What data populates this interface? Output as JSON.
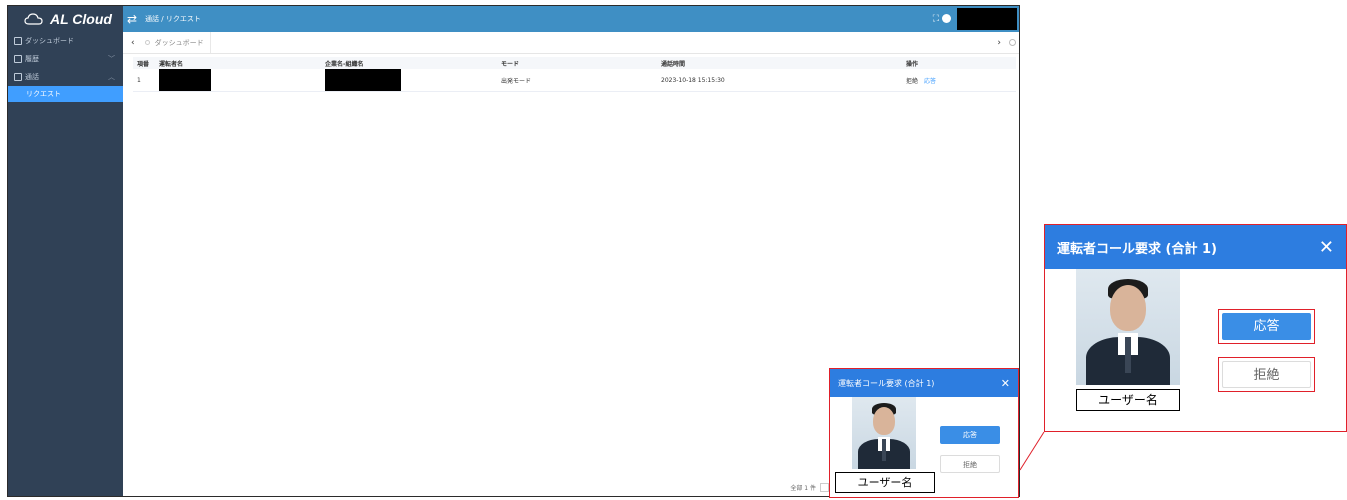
{
  "app": {
    "logo": "AL Cloud",
    "breadcrumb": "通話 / リクエスト"
  },
  "sidebar": {
    "items": [
      {
        "label": "ダッシュボード",
        "arrow": ""
      },
      {
        "label": "履歴",
        "arrow": "﹀"
      },
      {
        "label": "通話",
        "arrow": "︿"
      }
    ],
    "sub_active": "リクエスト"
  },
  "tags": {
    "current": "ダッシュボード",
    "prev": "‹",
    "next": "›"
  },
  "table": {
    "headers": [
      "項番",
      "運転者名",
      "企業名-組織名",
      "モード",
      "通話時間",
      "操作"
    ],
    "rows": [
      {
        "no": "1",
        "driver": "",
        "company": "",
        "mode": "出発モード",
        "time": "2023-10-18 15:15:30",
        "reject": "拒絶",
        "accept": "応答"
      }
    ]
  },
  "pager": {
    "total": "全部 1 件"
  },
  "popup": {
    "title": "運転者コール要求 (合計 1)",
    "close": "✕",
    "accept": "応答",
    "reject": "拒絶",
    "username": "ユーザー名"
  },
  "colors": {
    "sidebar": "#304156",
    "topbar": "#3f8fc4",
    "popup_header": "#2d7de0",
    "highlight": "#e0202a"
  }
}
